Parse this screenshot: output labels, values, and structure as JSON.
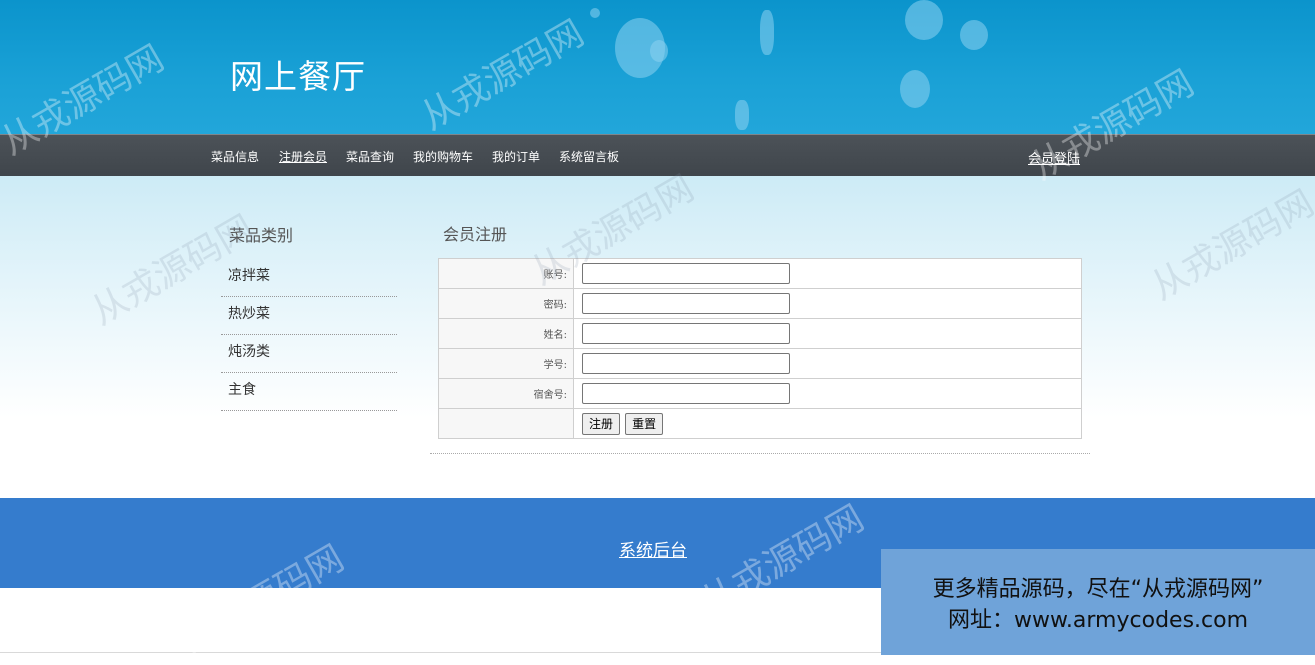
{
  "header": {
    "title": "网上餐厅"
  },
  "nav": {
    "items": [
      {
        "label": "菜品信息",
        "active": false
      },
      {
        "label": "注册会员",
        "active": true
      },
      {
        "label": "菜品查询",
        "active": false
      },
      {
        "label": "我的购物车",
        "active": false
      },
      {
        "label": "我的订单",
        "active": false
      },
      {
        "label": "系统留言板",
        "active": false
      }
    ],
    "login_label": "会员登陆"
  },
  "sidebar": {
    "title": "菜品类别",
    "categories": [
      "凉拌菜",
      "热炒菜",
      "炖汤类",
      "主食"
    ]
  },
  "form": {
    "title": "会员注册",
    "fields": [
      {
        "label": "账号:",
        "value": ""
      },
      {
        "label": "密码:",
        "value": ""
      },
      {
        "label": "姓名:",
        "value": ""
      },
      {
        "label": "学号:",
        "value": ""
      },
      {
        "label": "宿舍号:",
        "value": ""
      }
    ],
    "submit_label": "注册",
    "reset_label": "重置"
  },
  "footer": {
    "admin_link": "系统后台"
  },
  "ad": {
    "line1": "更多精品源码，尽在“从戎源码网”",
    "line2": "网址：www.armycodes.com"
  },
  "watermark": {
    "text": "从戎源码网"
  },
  "colors": {
    "header_bg": "#1aa1d6",
    "nav_bg": "#464c52",
    "footer_bg": "#357ccd",
    "ad_bg": "#6fa3d9"
  }
}
